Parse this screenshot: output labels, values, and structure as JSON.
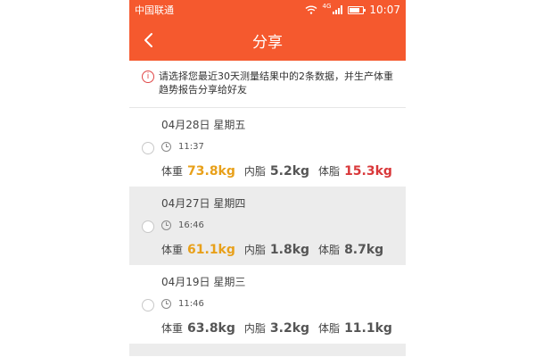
{
  "status_bar": {
    "carrier": "中国联通",
    "network": "4G",
    "time": "10:07"
  },
  "nav": {
    "title": "分享",
    "back_icon": "chevron-left-icon"
  },
  "notice": {
    "icon": "info-icon",
    "icon_glyph": "i",
    "text": "请选择您最近30天测量结果中的2条数据，并生产体重趋势报告分享给好友"
  },
  "labels": {
    "weight": "体重",
    "visceral_fat": "内脂",
    "body_fat": "体脂"
  },
  "records": [
    {
      "date": "04月28日 星期五",
      "time": "11:37",
      "weight": "73.8kg",
      "visceral_fat": "5.2kg",
      "body_fat": "15.3kg",
      "weight_color": "#e8a01a",
      "body_fat_color": "#d9383a"
    },
    {
      "date": "04月27日 星期四",
      "time": "16:46",
      "weight": "61.1kg",
      "visceral_fat": "1.8kg",
      "body_fat": "8.7kg",
      "weight_color": "#e8a01a",
      "body_fat_color": "#555555"
    },
    {
      "date": "04月19日 星期三",
      "time": "11:46",
      "weight": "63.8kg",
      "visceral_fat": "3.2kg",
      "body_fat": "11.1kg",
      "weight_color": "#555555",
      "body_fat_color": "#555555"
    }
  ],
  "colors": {
    "accent": "#f5592e",
    "shaded_row": "#ececec"
  }
}
